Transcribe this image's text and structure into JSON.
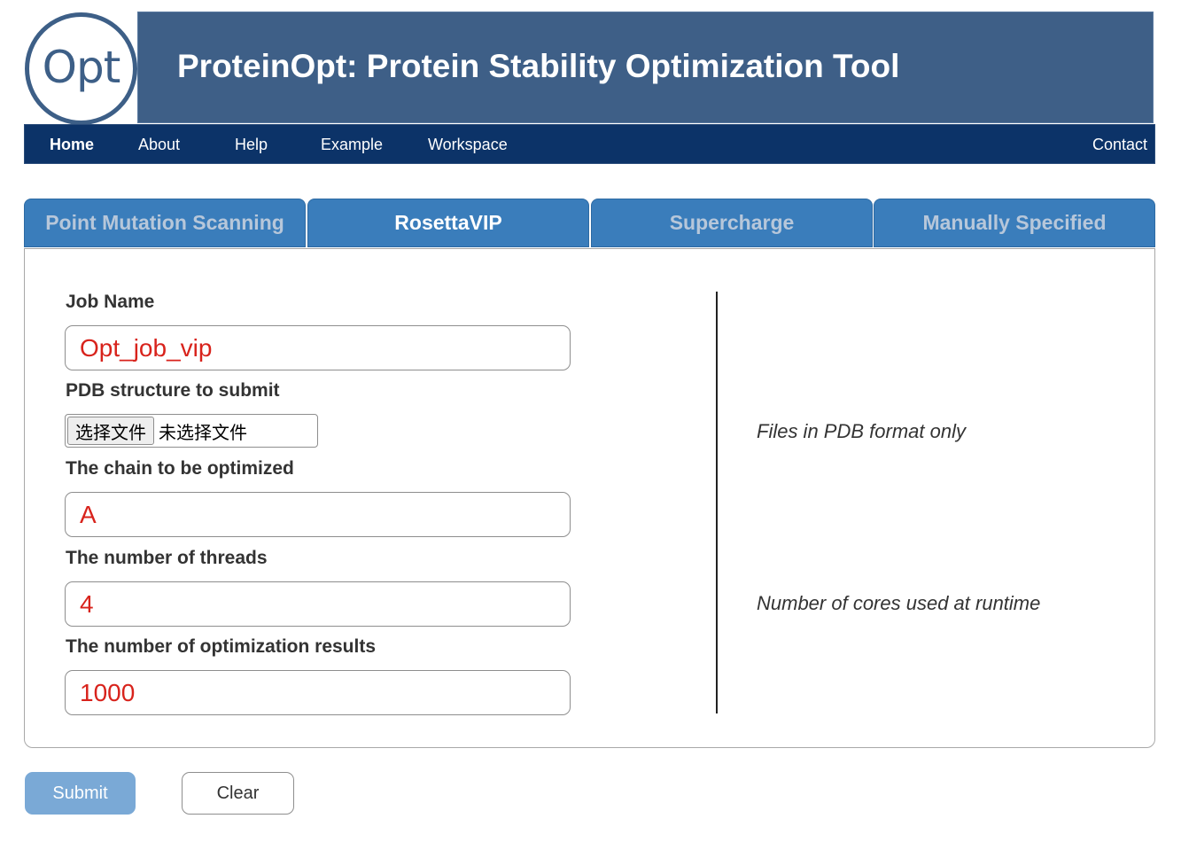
{
  "header": {
    "logo_text": "Opt",
    "title": "ProteinOpt: Protein Stability Optimization Tool"
  },
  "nav": {
    "items": [
      "Home",
      "About",
      "Help",
      "Example",
      "Workspace"
    ],
    "active": "Home",
    "right_item": "Contact"
  },
  "tabs": {
    "items": [
      "Point Mutation Scanning",
      "RosettaVIP",
      "Supercharge",
      "Manually Specified"
    ],
    "active": "RosettaVIP"
  },
  "form": {
    "job_name": {
      "label": "Job Name",
      "value": "Opt_job_vip"
    },
    "pdb": {
      "label": "PDB structure to submit",
      "button": "选择文件",
      "status": "未选择文件",
      "hint": "Files in PDB format only"
    },
    "chain": {
      "label": "The chain to be optimized",
      "value": "A"
    },
    "threads": {
      "label": "The number of threads",
      "value": "4",
      "hint": "Number of cores used at runtime"
    },
    "results": {
      "label": "The number of optimization results",
      "value": "1000"
    }
  },
  "buttons": {
    "submit": "Submit",
    "clear": "Clear"
  },
  "colors": {
    "banner": "#3e5f87",
    "navbar": "#0c3368",
    "tab": "#3a7dbb",
    "input_text": "#d8231c",
    "submit": "#7aa9d6"
  }
}
